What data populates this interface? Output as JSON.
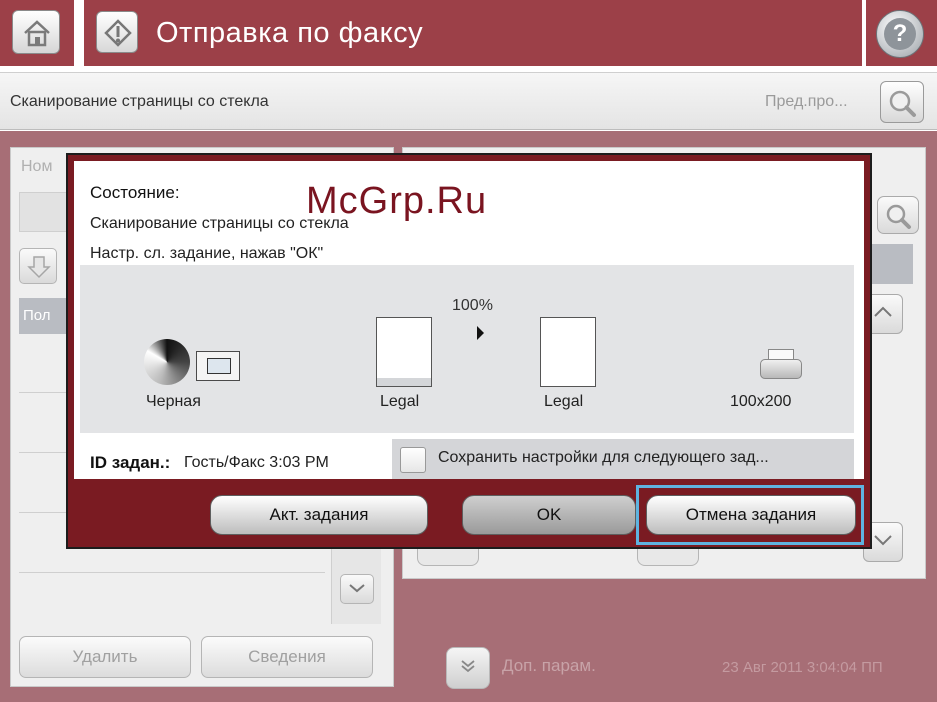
{
  "header": {
    "title": "Отправка по факсу",
    "help_symbol": "?",
    "icons": [
      "home-icon",
      "fax-icon",
      "help-icon"
    ]
  },
  "status_bar": {
    "text": "Сканирование страницы со стекла",
    "preview_label": "Пред.про...",
    "preview_icon": "magnifier-icon"
  },
  "background_screen": {
    "left_panel_label": "Ном",
    "list_header": "Пол",
    "delete_button": "Удалить",
    "details_button": "Сведения",
    "more_options": "Доп. парам.",
    "datetime": "23 Авг 2011 3:04:04 ПП"
  },
  "dialog": {
    "status_label": "Состояние:",
    "line1": "Сканирование страницы со стекла",
    "line2": "Настр. сл. задание, нажав \"ОК\"",
    "scale": "100%",
    "color_caption": "Черная",
    "original_size": "Legal",
    "output_size": "Legal",
    "resolution": "100x200",
    "job_id_label": "ID задан.:",
    "job_id_value": "Гость/Факс 3:03 PM",
    "save_settings_label": "Сохранить настройки для следующего зад...",
    "save_settings_checked": false,
    "buttons": {
      "active_jobs": "Акт. задания",
      "ok": "OK",
      "cancel_job": "Отмена задания"
    }
  },
  "watermark": "McGrp.Ru",
  "colors": {
    "header_bar": "#9c4048",
    "dialog_frame": "#7a1b22",
    "workspace": "#a76e76",
    "highlight": "#5fb3e0"
  }
}
